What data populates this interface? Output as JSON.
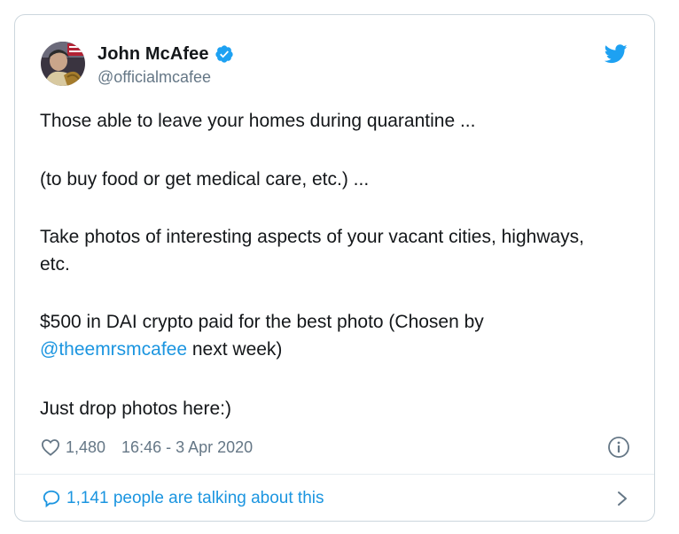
{
  "author": {
    "display_name": "John McAfee",
    "handle": "@officialmcafee",
    "verified": true
  },
  "tweet": {
    "line1": "Those able to leave your homes during quarantine ...",
    "line2": " (to buy food or get medical care, etc.) ...",
    "line3": "Take photos of interesting aspects of your vacant cities, highways, etc.",
    "line4_prefix": "$500 in DAI crypto paid for the best photo (Chosen by ",
    "line4_mention": "@theemrsmcafee",
    "line4_suffix": " next week)",
    "line5": "Just drop photos here:)"
  },
  "meta": {
    "like_count": "1,480",
    "timestamp": "16:46 - 3 Apr 2020"
  },
  "footer": {
    "talking_text": "1,141 people are talking about this"
  },
  "icons": {
    "brand": "twitter-bird-icon",
    "verified": "verified-badge-icon",
    "like": "heart-icon",
    "info": "info-icon",
    "talk": "speech-bubble-icon",
    "chevron": "chevron-right-icon"
  },
  "colors": {
    "accent": "#1da1f2",
    "link": "#1b95e0",
    "text": "#14171a",
    "muted": "#657786",
    "border": "#ccd6dd"
  }
}
